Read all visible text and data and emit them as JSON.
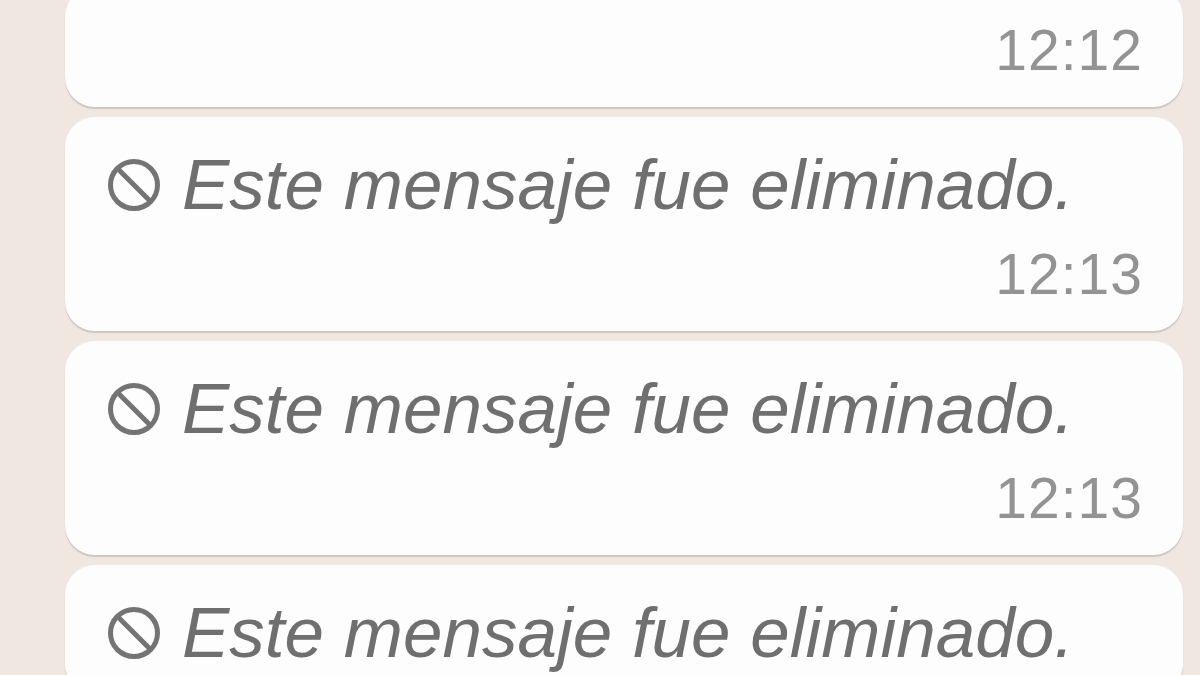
{
  "messages": [
    {
      "time": "12:12"
    },
    {
      "deleted": true,
      "text": "Este mensaje fue eliminado.",
      "time": "12:13"
    },
    {
      "deleted": true,
      "text": "Este mensaje fue eliminado.",
      "time": "12:13"
    },
    {
      "deleted": true,
      "text": "Este mensaje fue eliminado."
    }
  ]
}
